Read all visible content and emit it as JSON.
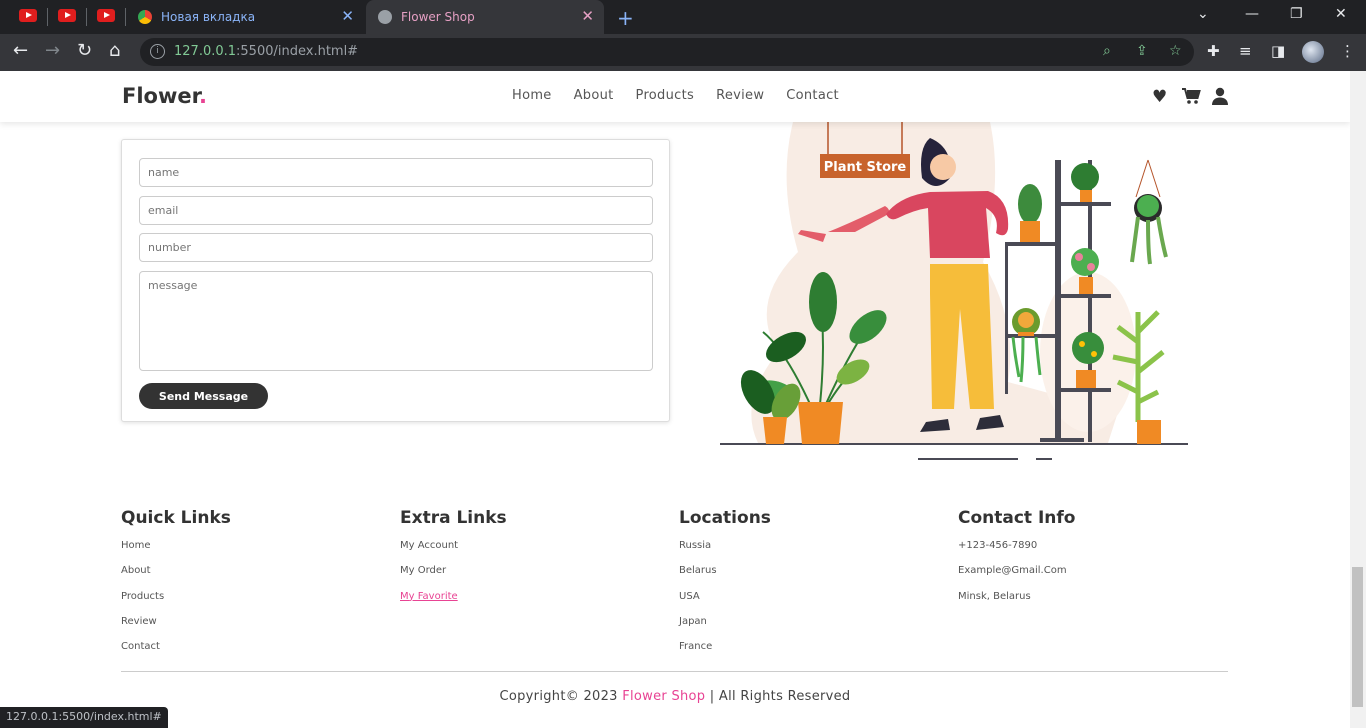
{
  "browser": {
    "tabs": [
      {
        "title": "Новая вкладка"
      },
      {
        "title": "Flower Shop"
      }
    ],
    "url_host": "127.0.0.1",
    "url_rest": ":5500/index.html#",
    "status_url": "127.0.0.1:5500/index.html#"
  },
  "header": {
    "logo": "Flower",
    "logo_dot": ".",
    "nav": [
      "Home",
      "About",
      "Products",
      "Review",
      "Contact"
    ]
  },
  "contact_form": {
    "name_placeholder": "name",
    "email_placeholder": "email",
    "number_placeholder": "number",
    "message_placeholder": "message",
    "submit_label": "Send Message"
  },
  "illustration": {
    "sign_text": "Plant Store"
  },
  "footer": {
    "quick_links": {
      "title": "Quick Links",
      "items": [
        "Home",
        "About",
        "Products",
        "Review",
        "Contact"
      ]
    },
    "extra_links": {
      "title": "Extra Links",
      "items": [
        "My Account",
        "My Order",
        "My Favorite"
      ]
    },
    "locations": {
      "title": "Locations",
      "items": [
        "Russia",
        "Belarus",
        "USA",
        "Japan",
        "France"
      ]
    },
    "contact_info": {
      "title": "Contact Info",
      "items": [
        "+123-456-7890",
        "Example@Gmail.Com",
        "Minsk, Belarus"
      ]
    },
    "copyright_prefix": "Copyright© 2023",
    "copyright_brand": "Flower Shop",
    "copyright_suffix": "| All Rights Reserved"
  },
  "colors": {
    "accent": "#e84393",
    "dark": "#333333"
  }
}
